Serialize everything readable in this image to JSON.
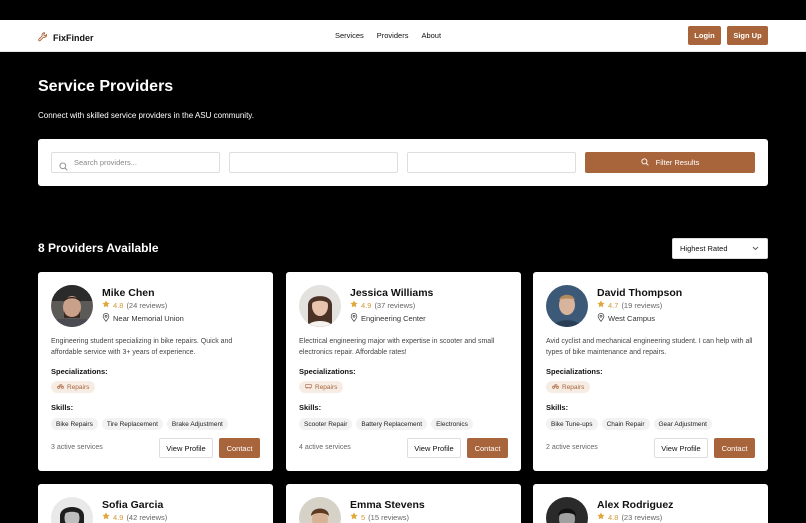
{
  "nav": {
    "brand": "FixFinder",
    "links": [
      "Services",
      "Providers",
      "About"
    ],
    "login": "Login",
    "signup": "Sign Up"
  },
  "hero": {
    "title": "Service Providers",
    "subtitle": "Connect with skilled service providers in the ASU community."
  },
  "filters": {
    "search_placeholder": "Search providers...",
    "field2_value": "",
    "field3_value": "",
    "button": "Filter Results"
  },
  "results": {
    "count_title": "8 Providers Available",
    "sort_selected": "Highest Rated"
  },
  "labels": {
    "specializations": "Specializations:",
    "skills": "Skills:",
    "view_profile": "View Profile",
    "contact": "Contact"
  },
  "providers": [
    {
      "name": "Mike Chen",
      "rating": "4.8",
      "reviews": "(24 reviews)",
      "location": "Near Memorial Union",
      "description": "Engineering student specializing in bike repairs. Quick and affordable service with 3+ years of experience.",
      "specialization": "Repairs",
      "skills": [
        "Bike Repairs",
        "Tire Replacement",
        "Brake Adjustment"
      ],
      "active_services": "3 active services"
    },
    {
      "name": "Jessica Williams",
      "rating": "4.9",
      "reviews": "(37 reviews)",
      "location": "Engineering Center",
      "description": "Electrical engineering major with expertise in scooter and small electronics repair. Affordable rates!",
      "specialization": "Repairs",
      "skills": [
        "Scooter Repair",
        "Battery Replacement",
        "Electronics"
      ],
      "active_services": "4 active services"
    },
    {
      "name": "David Thompson",
      "rating": "4.7",
      "reviews": "(19 reviews)",
      "location": "West Campus",
      "description": "Avid cyclist and mechanical engineering student. I can help with all types of bike maintenance and repairs.",
      "specialization": "Repairs",
      "skills": [
        "Bike Tune-ups",
        "Chain Repair",
        "Gear Adjustment"
      ],
      "active_services": "2 active services"
    },
    {
      "name": "Sofia Garcia",
      "rating": "4.9",
      "reviews": "(42 reviews)"
    },
    {
      "name": "Emma Stevens",
      "rating": "5",
      "reviews": "(15 reviews)"
    },
    {
      "name": "Alex Rodriguez",
      "rating": "4.8",
      "reviews": "(23 reviews)"
    }
  ],
  "colors": {
    "accent": "#a8653b",
    "star": "#d29a3a",
    "background": "#000000"
  },
  "icons": [
    "wrench-icon",
    "search-icon",
    "star-icon",
    "map-pin-icon",
    "repair-tag-icon",
    "chevron-down-icon"
  ]
}
